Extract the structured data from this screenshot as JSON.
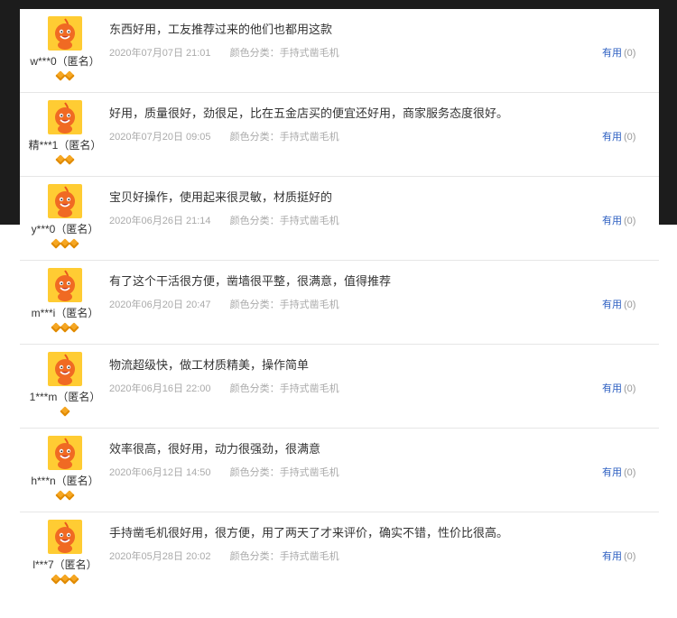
{
  "colors": {
    "accent": "#2f61c2",
    "avatar_bg": "#ffcc33",
    "badge": "#f5a623",
    "top_band": "#1c1c1c"
  },
  "icons": {
    "avatar": "orange-mascot-avatar-icon",
    "badge": "diamond-badge-icon"
  },
  "reviews": [
    {
      "user": "w***0（匿名）",
      "badges": 2,
      "text": "东西好用，工友推荐过来的他们也都用这款",
      "date": "2020年07月07日 21:01",
      "sku": "颜色分类：手持式凿毛机",
      "useful_label": "有用",
      "useful_count": "(0)"
    },
    {
      "user": "精***1（匿名）",
      "badges": 2,
      "text": "好用，质量很好，劲很足，比在五金店买的便宜还好用，商家服务态度很好。",
      "date": "2020年07月20日 09:05",
      "sku": "颜色分类：手持式凿毛机",
      "useful_label": "有用",
      "useful_count": "(0)"
    },
    {
      "user": "y***0（匿名）",
      "badges": 3,
      "text": "宝贝好操作，使用起来很灵敏，材质挺好的",
      "date": "2020年06月26日 21:14",
      "sku": "颜色分类：手持式凿毛机",
      "useful_label": "有用",
      "useful_count": "(0)"
    },
    {
      "user": "m***i（匿名）",
      "badges": 3,
      "text": "有了这个干活很方便，凿墙很平整，很满意，值得推荐",
      "date": "2020年06月20日 20:47",
      "sku": "颜色分类：手持式凿毛机",
      "useful_label": "有用",
      "useful_count": "(0)"
    },
    {
      "user": "1***m（匿名）",
      "badges": 1,
      "text": "物流超级快，做工材质精美，操作简单",
      "date": "2020年06月16日 22:00",
      "sku": "颜色分类：手持式凿毛机",
      "useful_label": "有用",
      "useful_count": "(0)"
    },
    {
      "user": "h***n（匿名）",
      "badges": 2,
      "text": "效率很高，很好用，动力很强劲，很满意",
      "date": "2020年06月12日 14:50",
      "sku": "颜色分类：手持式凿毛机",
      "useful_label": "有用",
      "useful_count": "(0)"
    },
    {
      "user": "l***7（匿名）",
      "badges": 3,
      "text": "手持凿毛机很好用，很方便，用了两天了才来评价，确实不错，性价比很高。",
      "date": "2020年05月28日 20:02",
      "sku": "颜色分类：手持式凿毛机",
      "useful_label": "有用",
      "useful_count": "(0)"
    }
  ]
}
